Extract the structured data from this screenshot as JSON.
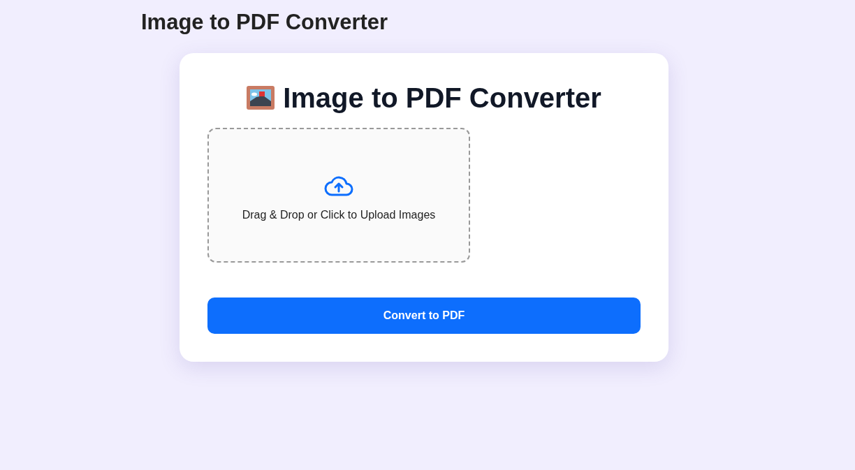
{
  "page_title": "Image to PDF Converter",
  "card": {
    "title": "Image to PDF Converter",
    "dropzone": {
      "label": "Drag & Drop or Click to Upload Images"
    },
    "convert_button": "Convert to PDF"
  }
}
